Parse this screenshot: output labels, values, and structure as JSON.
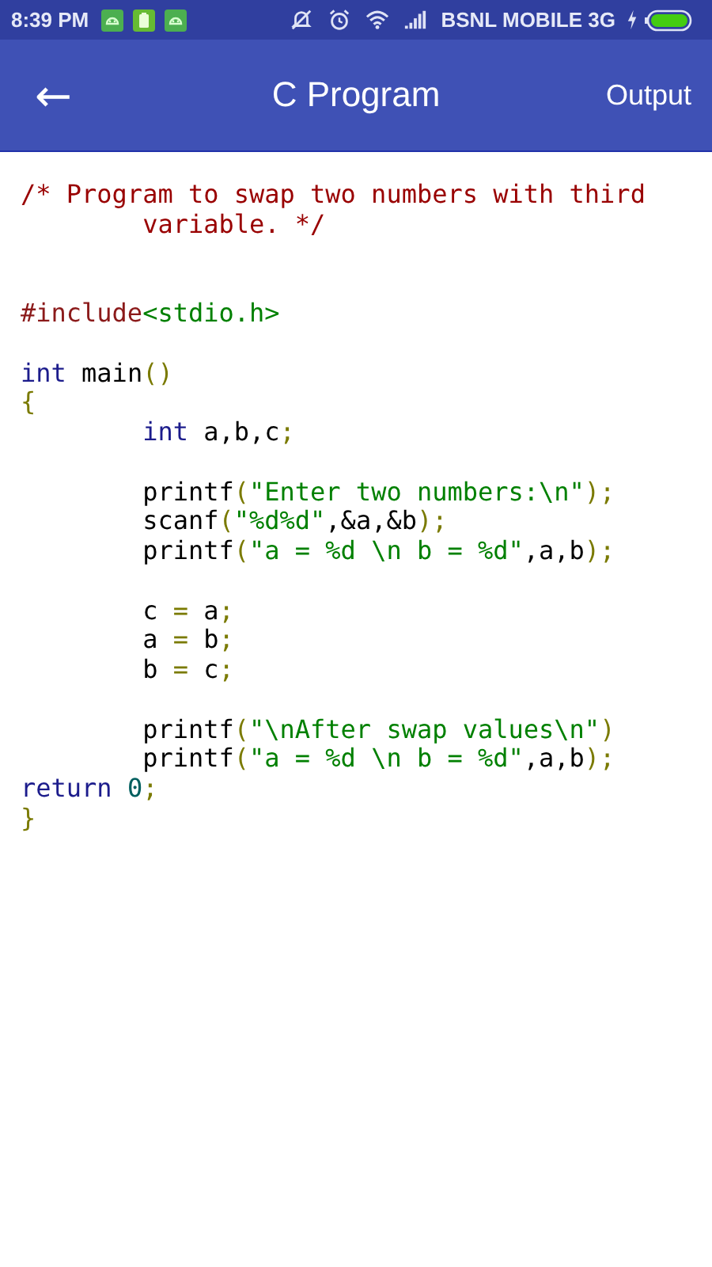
{
  "status_bar": {
    "time": "8:39 PM",
    "notifications": [
      {
        "kind": "android"
      },
      {
        "kind": "clipboard"
      },
      {
        "kind": "android"
      }
    ],
    "carrier": "BSNL MOBILE 3G"
  },
  "app_bar": {
    "back": "←",
    "title": "C Program",
    "action": "Output"
  },
  "code_lines": [
    {
      "kind": "code",
      "tokens": [
        {
          "kind": "comment",
          "text": "/* Program to swap two numbers with third"
        }
      ]
    },
    {
      "kind": "code",
      "indent": true,
      "tokens": [
        {
          "kind": "comment",
          "text": "variable. */"
        }
      ]
    },
    {
      "kind": "blank"
    },
    {
      "kind": "blank"
    },
    {
      "kind": "code",
      "tokens": [
        {
          "kind": "preprocessor",
          "text": "#include"
        },
        {
          "kind": "string",
          "text": "<stdio.h>"
        }
      ]
    },
    {
      "kind": "blank"
    },
    {
      "kind": "code",
      "tokens": [
        {
          "kind": "keyword",
          "text": "int"
        },
        {
          "kind": "plain",
          "text": " main"
        },
        {
          "kind": "punct",
          "text": "()"
        }
      ]
    },
    {
      "kind": "code",
      "tokens": [
        {
          "kind": "punct",
          "text": "{"
        }
      ]
    },
    {
      "kind": "code",
      "indent": true,
      "tokens": [
        {
          "kind": "keyword",
          "text": "int"
        },
        {
          "kind": "plain",
          "text": " a,b,c"
        },
        {
          "kind": "punct",
          "text": ";"
        }
      ]
    },
    {
      "kind": "blank"
    },
    {
      "kind": "code",
      "tokens": [
        {
          "kind": "plain",
          "text": "        printf"
        },
        {
          "kind": "punct",
          "text": "("
        },
        {
          "kind": "string",
          "text": "\"Enter two numbers:\\n\""
        },
        {
          "kind": "punct",
          "text": ");"
        }
      ]
    },
    {
      "kind": "code",
      "tokens": [
        {
          "kind": "plain",
          "text": "        scanf"
        },
        {
          "kind": "punct",
          "text": "("
        },
        {
          "kind": "string",
          "text": "\"%d%d\""
        },
        {
          "kind": "plain",
          "text": ",&a,&b"
        },
        {
          "kind": "punct",
          "text": ");"
        }
      ]
    },
    {
      "kind": "code",
      "tokens": [
        {
          "kind": "plain",
          "text": "        printf"
        },
        {
          "kind": "punct",
          "text": "("
        },
        {
          "kind": "string",
          "text": "\"a = %d \\n b = %d\""
        },
        {
          "kind": "plain",
          "text": ",a,b"
        },
        {
          "kind": "punct",
          "text": ");"
        }
      ]
    },
    {
      "kind": "blank"
    },
    {
      "kind": "code",
      "tokens": [
        {
          "kind": "plain",
          "text": "        c "
        },
        {
          "kind": "punct",
          "text": "="
        },
        {
          "kind": "plain",
          "text": " a"
        },
        {
          "kind": "punct",
          "text": ";"
        }
      ]
    },
    {
      "kind": "code",
      "tokens": [
        {
          "kind": "plain",
          "text": "        a "
        },
        {
          "kind": "punct",
          "text": "="
        },
        {
          "kind": "plain",
          "text": " b"
        },
        {
          "kind": "punct",
          "text": ";"
        }
      ]
    },
    {
      "kind": "code",
      "tokens": [
        {
          "kind": "plain",
          "text": "        b "
        },
        {
          "kind": "punct",
          "text": "="
        },
        {
          "kind": "plain",
          "text": " c"
        },
        {
          "kind": "punct",
          "text": ";"
        }
      ]
    },
    {
      "kind": "blank"
    },
    {
      "kind": "code",
      "tokens": [
        {
          "kind": "plain",
          "text": "        printf"
        },
        {
          "kind": "punct",
          "text": "("
        },
        {
          "kind": "string",
          "text": "\"\\nAfter swap values\\n\""
        },
        {
          "kind": "punct",
          "text": ")"
        }
      ]
    },
    {
      "kind": "code",
      "tokens": [
        {
          "kind": "plain",
          "text": "        printf"
        },
        {
          "kind": "punct",
          "text": "("
        },
        {
          "kind": "string",
          "text": "\"a = %d \\n b = %d\""
        },
        {
          "kind": "plain",
          "text": ",a,b"
        },
        {
          "kind": "punct",
          "text": ");"
        }
      ]
    },
    {
      "kind": "code",
      "tokens": [
        {
          "kind": "keyword",
          "text": "return "
        },
        {
          "kind": "number",
          "text": "0"
        },
        {
          "kind": "punct",
          "text": ";"
        }
      ]
    },
    {
      "kind": "code",
      "tokens": [
        {
          "kind": "punct",
          "text": "}"
        }
      ]
    }
  ]
}
